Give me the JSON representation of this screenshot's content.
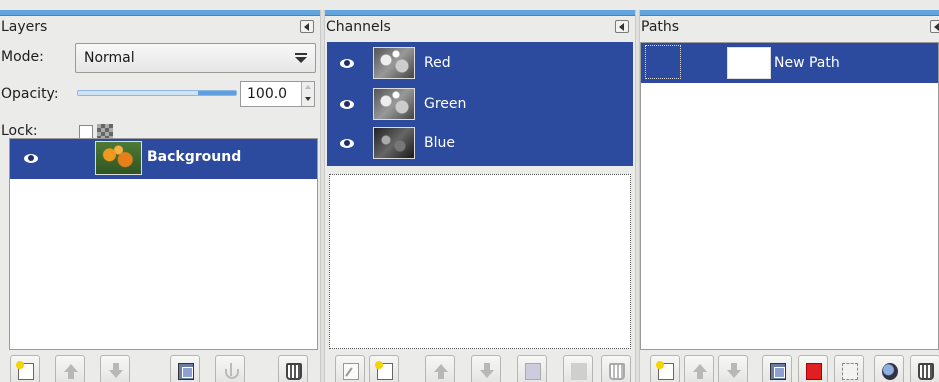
{
  "layers": {
    "title": "Layers",
    "mode_label": "Mode:",
    "mode_value": "Normal",
    "opacity_label": "Opacity:",
    "opacity_value": "100.0",
    "opacity_level": 1.0,
    "lock_label": "Lock:",
    "items": [
      {
        "label": "Background",
        "visible": true
      }
    ],
    "toolbar": [
      "new-layer-icon",
      "raise-layer-icon",
      "lower-layer-icon",
      "duplicate-layer-icon",
      "anchor-icon",
      "delete-icon"
    ]
  },
  "channels": {
    "title": "Channels",
    "items": [
      {
        "label": "Red",
        "visible": true
      },
      {
        "label": "Green",
        "visible": true
      },
      {
        "label": "Blue",
        "visible": true
      }
    ],
    "toolbar": [
      "edit-channel-icon",
      "new-channel-icon",
      "raise-channel-icon",
      "lower-channel-icon",
      "duplicate-channel-icon",
      "channel-to-selection-icon",
      "delete-icon"
    ]
  },
  "paths": {
    "title": "Paths",
    "items": [
      {
        "label": "New Path"
      }
    ],
    "toolbar": [
      "new-path-icon",
      "raise-path-icon",
      "lower-path-icon",
      "duplicate-path-icon",
      "path-to-selection-icon",
      "selection-to-path-icon",
      "paint-along-path-icon",
      "delete-icon"
    ]
  },
  "colors": {
    "selection": "#2c4a9e",
    "accent_bar": "#62a4de"
  }
}
